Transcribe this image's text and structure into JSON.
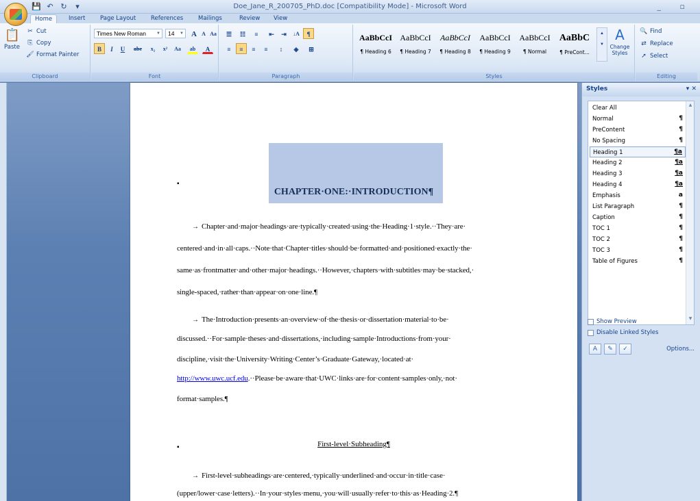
{
  "window": {
    "title": "Doe_Jane_R_200705_PhD.doc [Compatibility Mode] - Microsoft Word",
    "controls": "_ ▫"
  },
  "qat": {
    "save": "💾",
    "undo": "↶",
    "redo": "↻",
    "customize": "▾"
  },
  "tabs": [
    "Home",
    "Insert",
    "Page Layout",
    "References",
    "Mailings",
    "Review",
    "View"
  ],
  "ribbon": {
    "clipboard": {
      "paste": "Paste",
      "cut": "Cut",
      "copy": "Copy",
      "format_painter": "Format Painter",
      "label": "Clipboard"
    },
    "font": {
      "name": "Times New Roman",
      "size": "14",
      "label": "Font",
      "grow": "A",
      "shrink": "A",
      "clear": "Aa",
      "bold": "B",
      "italic": "I",
      "underline": "U",
      "strike": "abe",
      "sub": "x₂",
      "sup": "x²",
      "change_case": "Aa",
      "highlight": "ab",
      "color": "A"
    },
    "paragraph": {
      "label": "Paragraph",
      "show_marks": "¶",
      "sort": "↓A"
    },
    "styles": {
      "label": "Styles",
      "tiles": [
        {
          "sample": "AaBbCcI",
          "name": "¶ Heading 6",
          "kind": "bold"
        },
        {
          "sample": "AaBbCcI",
          "name": "¶ Heading 7",
          "kind": "plain"
        },
        {
          "sample": "AaBbCcI",
          "name": "¶ Heading 8",
          "kind": "italic"
        },
        {
          "sample": "AaBbCcI",
          "name": "¶ Heading 9",
          "kind": "plain"
        },
        {
          "sample": "AaBbCcI",
          "name": "¶ Normal",
          "kind": "plain"
        },
        {
          "sample": "AaBbC",
          "name": "¶ PreCont...",
          "kind": "bold"
        }
      ],
      "change_styles": "Change Styles"
    },
    "editing": {
      "label": "Editing",
      "find": "Find",
      "replace": "Replace",
      "select": "Select"
    }
  },
  "document": {
    "chapter_title": "CHAPTER·ONE:·INTRODUCTION¶",
    "para1": [
      "Chapter·and·major·headings·are·typically·created·using·the·Heading·1·style.··They·are·",
      "centered·and·in·all·caps.··Note·that·Chapter·titles·should·be·formatted·and·positioned·exactly·the·",
      "same·as·frontmatter·and·other·major·headings.··However,·chapters·with·subtitles·may·be·stacked,·",
      "single-spaced,·rather·than·appear·on·one·line.¶"
    ],
    "para2": [
      "The·Introduction·presents·an·overview·of·the·thesis·or·dissertation·material·to·be·",
      "discussed.··For·sample·theses·and·dissertations,·including·sample·Introductions·from·your·",
      "discipline,·visit·the·University·Writing·Center’s·Graduate·Gateway,·located·at·"
    ],
    "para2_link": "http://www.uwc.ucf.edu",
    "para2_after_link": ".··Please·be·aware·that·UWC·links·are·for·content·samples·only,·not·",
    "para2_last": "format·samples.¶",
    "subheading": "First-level·Subheading¶",
    "para3": [
      "First-level·subheadings·are·centered,·typically·underlined·and·occur·in·title·case·",
      "(upper/lower·case·letters).··In·your·styles·menu,·you·will·usually·refer·to·this·as·Heading·2.¶"
    ],
    "arrow": "→",
    "bullet": "▪"
  },
  "styles_pane": {
    "title": "Styles",
    "items": [
      {
        "name": "Clear All",
        "mark": ""
      },
      {
        "name": "Normal",
        "mark": "¶"
      },
      {
        "name": "PreContent",
        "mark": "¶"
      },
      {
        "name": "No Spacing",
        "mark": "¶"
      },
      {
        "name": "Heading 1",
        "mark": "¶a"
      },
      {
        "name": "Heading 2",
        "mark": "¶a"
      },
      {
        "name": "Heading 3",
        "mark": "¶a"
      },
      {
        "name": "Heading 4",
        "mark": "¶a"
      },
      {
        "name": "Emphasis",
        "mark": "a"
      },
      {
        "name": "List Paragraph",
        "mark": "¶"
      },
      {
        "name": "Caption",
        "mark": "¶"
      },
      {
        "name": "TOC 1",
        "mark": "¶"
      },
      {
        "name": "TOC 2",
        "mark": "¶"
      },
      {
        "name": "TOC 3",
        "mark": "¶"
      },
      {
        "name": "Table of Figures",
        "mark": "¶"
      }
    ],
    "selected": "Heading 1",
    "show_preview": "Show Preview",
    "disable_linked": "Disable Linked Styles",
    "options": "Options..."
  }
}
